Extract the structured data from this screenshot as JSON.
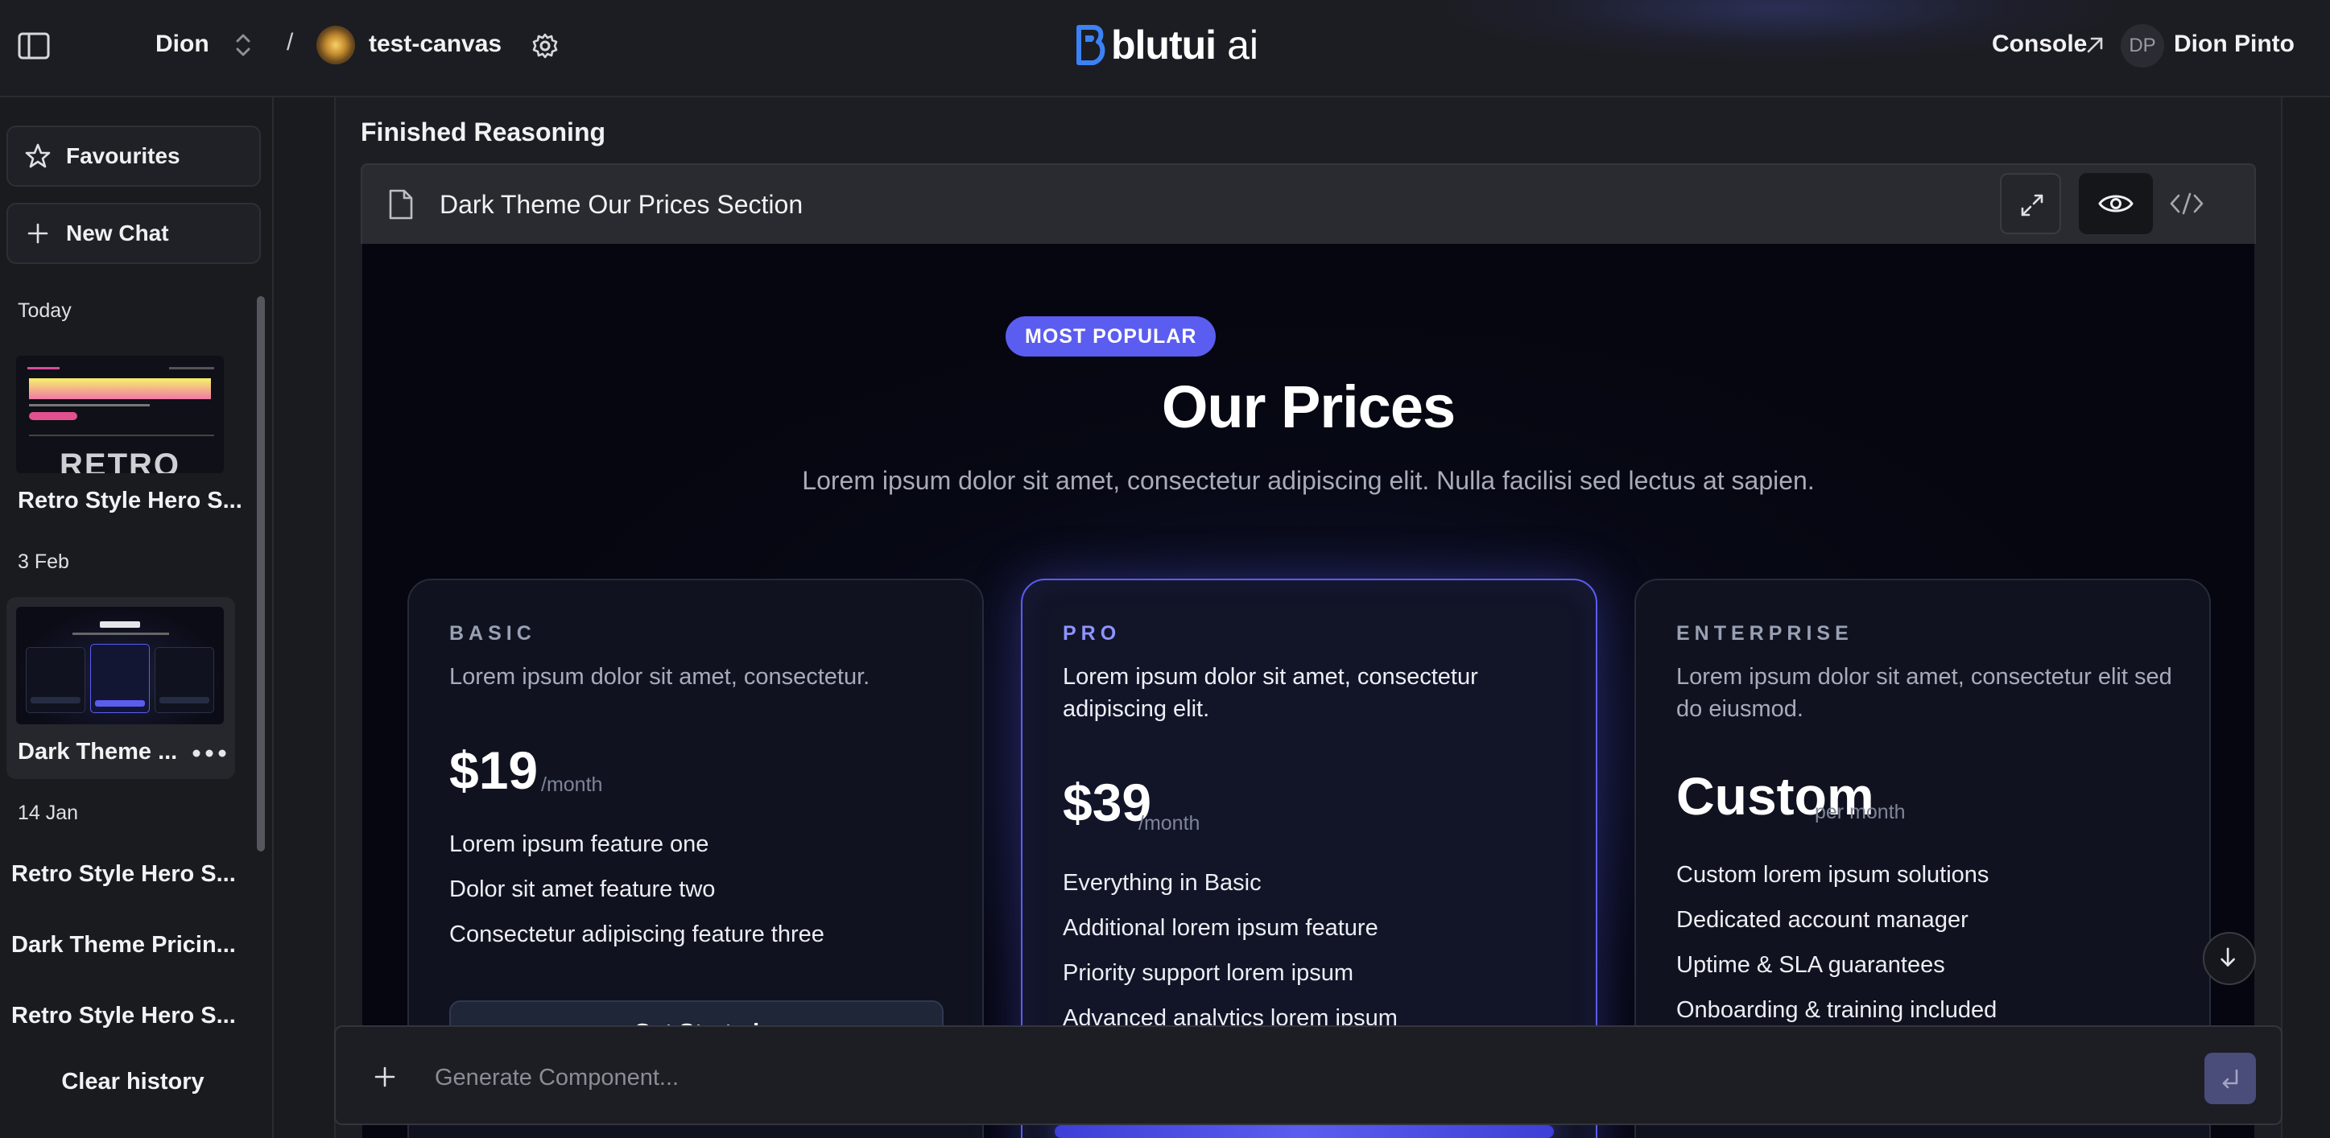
{
  "topbar": {
    "workspace": "Dion",
    "separator": "/",
    "project": "test-canvas",
    "brand": "blutui",
    "brand_suffix": "ai",
    "console": "Console",
    "user_initials": "DP",
    "user_name": "Dion Pinto"
  },
  "sidebar": {
    "favourites": "Favourites",
    "new_chat": "New Chat",
    "clear_history": "Clear history",
    "groups": [
      {
        "label": "Today",
        "items": [
          {
            "title": "Retro Style Hero S..."
          }
        ]
      },
      {
        "label": "3 Feb",
        "items": [
          {
            "title": "Dark Theme ..."
          }
        ]
      },
      {
        "label": "14 Jan",
        "items": [
          {
            "title": "Retro Style Hero S..."
          },
          {
            "title": "Dark Theme Pricin..."
          },
          {
            "title": "Retro Style Hero S..."
          }
        ]
      }
    ],
    "thumb_retro_text": "RETRO"
  },
  "main": {
    "status": "Finished Reasoning",
    "artifact_title": "Dark Theme Our Prices Section"
  },
  "preview": {
    "title": "Our Prices",
    "subtitle": "Lorem ipsum dolor sit amet, consectetur adipiscing elit. Nulla facilisi sed lectus at sapien.",
    "badge": "MOST POPULAR",
    "plans": [
      {
        "name": "BASIC",
        "desc": "Lorem ipsum dolor sit amet, consectetur.",
        "price": "$19",
        "per": "/month",
        "features": [
          "Lorem ipsum feature one",
          "Dolor sit amet feature two",
          "Consectetur adipiscing feature three"
        ],
        "cta": "Get Started"
      },
      {
        "name": "PRO",
        "desc": "Lorem ipsum dolor sit amet, consectetur adipiscing elit.",
        "price": "$39",
        "per": "/month",
        "features": [
          "Everything in Basic",
          "Additional lorem ipsum feature",
          "Priority support lorem ipsum",
          "Advanced analytics lorem ipsum"
        ]
      },
      {
        "name": "ENTERPRISE",
        "desc": "Lorem ipsum dolor sit amet, consectetur elit sed do eiusmod.",
        "price": "Custom",
        "per": "per month",
        "features": [
          "Custom lorem ipsum solutions",
          "Dedicated account manager",
          "Uptime & SLA guarantees",
          "Onboarding & training included"
        ]
      }
    ]
  },
  "composer": {
    "placeholder": "Generate Component..."
  },
  "colors": {
    "accent": "#5b5df0",
    "background": "#1a1b1f",
    "preview_background": "#05060f",
    "brand_mark": "#3b82f6"
  }
}
